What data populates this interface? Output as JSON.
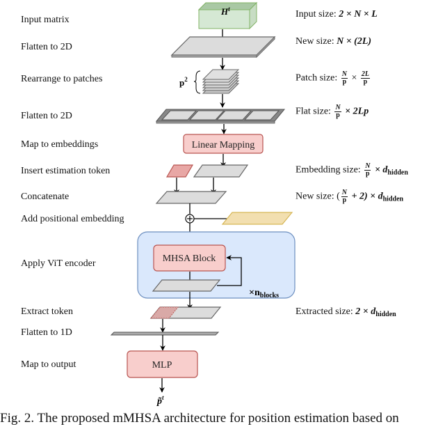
{
  "steps": [
    {
      "label": "Input  matrix"
    },
    {
      "label": "Flatten to 2D"
    },
    {
      "label": "Rearrange to patches"
    },
    {
      "label": "Flatten to 2D"
    },
    {
      "label": "Map to embeddings"
    },
    {
      "label": "Insert estimation token"
    },
    {
      "label": "Concatenate"
    },
    {
      "label": "Add positional embedding"
    },
    {
      "label": "Apply ViT encoder"
    },
    {
      "label": "Extract token"
    },
    {
      "label": "Flatten to 1D"
    },
    {
      "label": "Map to output"
    }
  ],
  "sizes": {
    "input": {
      "label": "Input size:",
      "expr": "2 × N × L"
    },
    "new1": {
      "label": "New size:",
      "expr": "N × (2L)"
    },
    "patch": {
      "label": "Patch size:",
      "frac1_num": "N",
      "frac1_den": "p",
      "times": "×",
      "frac2_num": "2L",
      "frac2_den": "p"
    },
    "flat": {
      "label": "Flat size:",
      "frac_num": "N",
      "frac_den": "p",
      "rest": "× 2Lp"
    },
    "embedding": {
      "label": "Embedding size:",
      "frac_num": "N",
      "frac_den": "p",
      "times": "× d",
      "sub": "hidden"
    },
    "new2": {
      "label": "New size:",
      "open": "(",
      "frac_num": "N",
      "frac_den": "p",
      "rest": "+ 2) × d",
      "sub": "hidden"
    },
    "extracted": {
      "label": "Extracted size:",
      "expr": "2 × d",
      "sub": "hidden"
    }
  },
  "nodes": {
    "input_tensor": "H",
    "input_tensor_sup": "t",
    "patch_count": "p",
    "patch_count_sup": "2",
    "linear_mapping": "Linear Mapping",
    "mhsa_block": "MHSA Block",
    "repeat_label": "×n",
    "repeat_sub": "blocks",
    "mlp": "MLP",
    "output": "p̃",
    "output_sup": "t"
  },
  "colors": {
    "green_fill": "#d5e8d4",
    "green_top": "#b9d3b5",
    "green_stroke": "#82b366",
    "gray_fill": "#dcdcdc",
    "gray_stroke": "#666666",
    "red_fill": "#f8cecc",
    "red_stroke": "#b85450",
    "yellow_fill": "#f2dfb0",
    "yellow_stroke": "#d6b656",
    "blue_fill": "#dae8fc",
    "blue_stroke": "#6c8ebf"
  },
  "caption": "Fig. 2.  The proposed mMHSA architecture for position estimation based on"
}
